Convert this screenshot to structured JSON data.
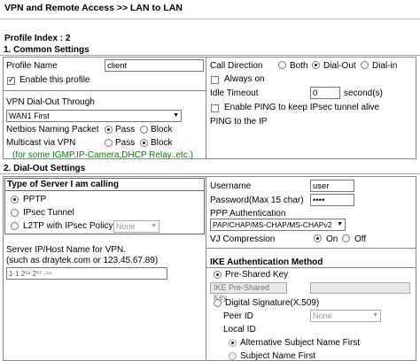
{
  "page": {
    "title": "VPN and Remote Access >> LAN to LAN"
  },
  "profile": {
    "index_label": "Profile Index : 2"
  },
  "common": {
    "header": "1. Common Settings",
    "profile_name_label": "Profile Name",
    "profile_name_value": "client",
    "enable_label": "Enable this profile",
    "dialout_through_label": "VPN Dial-Out Through",
    "dialout_through_value": "WAN1 First",
    "netbios_label": "Netbios Naming Packet",
    "pass_label": "Pass",
    "block_label": "Block",
    "multicast_label": "Multicast via VPN",
    "multicast_note": "(for some IGMP,IP-Camera,DHCP Relay..etc.)",
    "call_direction_label": "Call Direction",
    "both_label": "Both",
    "dialout_label": "Dial-Out",
    "dialin_label": "Dial-in",
    "always_on_label": "Always on",
    "idle_timeout_label": "Idle Timeout",
    "idle_timeout_value": "0",
    "idle_unit": "second(s)",
    "ping_enable_label": "Enable PING to keep IPsec tunnel alive",
    "ping_ip_label": "PING to the IP"
  },
  "dialout": {
    "header": "2. Dial-Out Settings",
    "server_type_label": "Type of Server I am calling",
    "pptp_label": "PPTP",
    "ipsec_label": "IPsec Tunnel",
    "l2tp_label": "L2TP with IPsec Policy",
    "l2tp_policy_value": "None",
    "server_ip_label": "Server IP/Host Name for VPN.",
    "server_ip_hint": "(such as draytek.com or 123.45.67.89)",
    "server_ip_value": "1·1 2⁵¹ 2⁰⁷ ·⁵⁵",
    "username_label": "Username",
    "username_value": "user",
    "password_label": "Password(Max 15 char)",
    "password_value": "••••",
    "ppp_auth_label": "PPP Authentication",
    "ppp_auth_value": "PAP/CHAP/MS-CHAP/MS-CHAPv2",
    "vj_label": "VJ Compression",
    "on_label": "On",
    "off_label": "Off",
    "ike_header": "IKE Authentication Method",
    "psk_label": "Pre-Shared Key",
    "ike_psk_button": "IKE Pre-Shared Key",
    "digital_sig_label": "Digital Signature(X.509)",
    "peer_id_label": "Peer ID",
    "peer_id_value": "None",
    "local_id_label": "Local ID",
    "alt_subject_label": "Alternative Subject Name First",
    "subject_label": "Subject Name First"
  }
}
